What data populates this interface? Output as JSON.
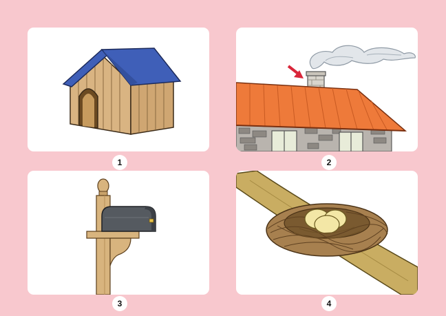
{
  "panels": [
    {
      "label": "1",
      "icon": "doghouse-icon"
    },
    {
      "label": "2",
      "icon": "chimney-house-icon"
    },
    {
      "label": "3",
      "icon": "mailbox-icon"
    },
    {
      "label": "4",
      "icon": "bird-nest-icon"
    }
  ],
  "colors": {
    "background": "#f8c8ce",
    "panel": "#ffffff",
    "doghouse_roof": "#3f5fb8",
    "doghouse_wood": "#d9b482",
    "house_roof": "#ee7a3a",
    "arrow": "#d9263a",
    "mailbox": "#555a60",
    "post": "#d8b47e",
    "nest": "#a7804f",
    "egg": "#f3e7a6"
  }
}
